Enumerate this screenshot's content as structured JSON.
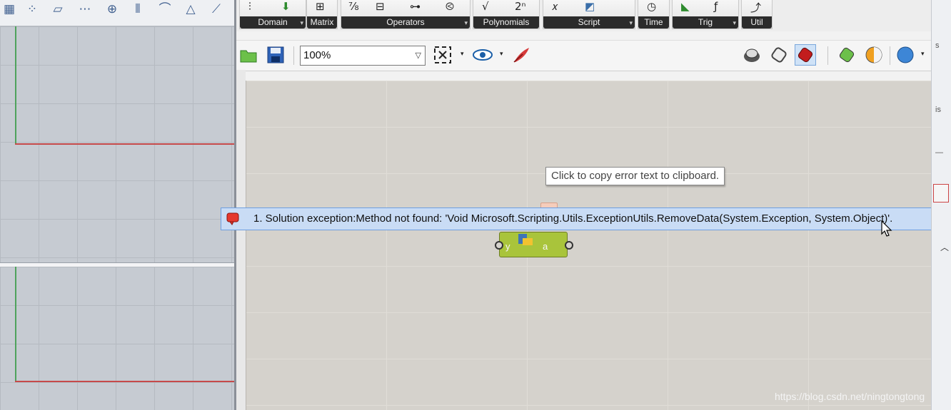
{
  "rhino_toolbar": {
    "icons": [
      "grid-icon",
      "point-cloud-icon",
      "plane-icon",
      "array-icon",
      "gumball-icon",
      "section-icon",
      "curve-icon",
      "cone-icon",
      "blend-icon"
    ]
  },
  "gh_tabs": {
    "groups": [
      {
        "label": "Domain"
      },
      {
        "label": "Matrix"
      },
      {
        "label": "Operators"
      },
      {
        "label": "Polynomials"
      },
      {
        "label": "Script"
      },
      {
        "label": "Time"
      },
      {
        "label": "Trig"
      },
      {
        "label": "Util"
      }
    ]
  },
  "gh_toolbar": {
    "zoom": "100%"
  },
  "component": {
    "input": "y",
    "output": "a"
  },
  "error": {
    "text": "1. Solution exception:Method not found: 'Void Microsoft.Scripting.Utils.ExceptionUtils.RemoveData(System.Exception, System.Object)'."
  },
  "tooltip": {
    "text": "Click to copy error text to clipboard."
  },
  "watermark": "https://blog.csdn.net/ningtongtong",
  "colors": {
    "error_bg": "#c9dcf5",
    "component_green": "#a9c43b",
    "axis_red": "#c64a4a",
    "axis_green": "#4fa35d"
  }
}
